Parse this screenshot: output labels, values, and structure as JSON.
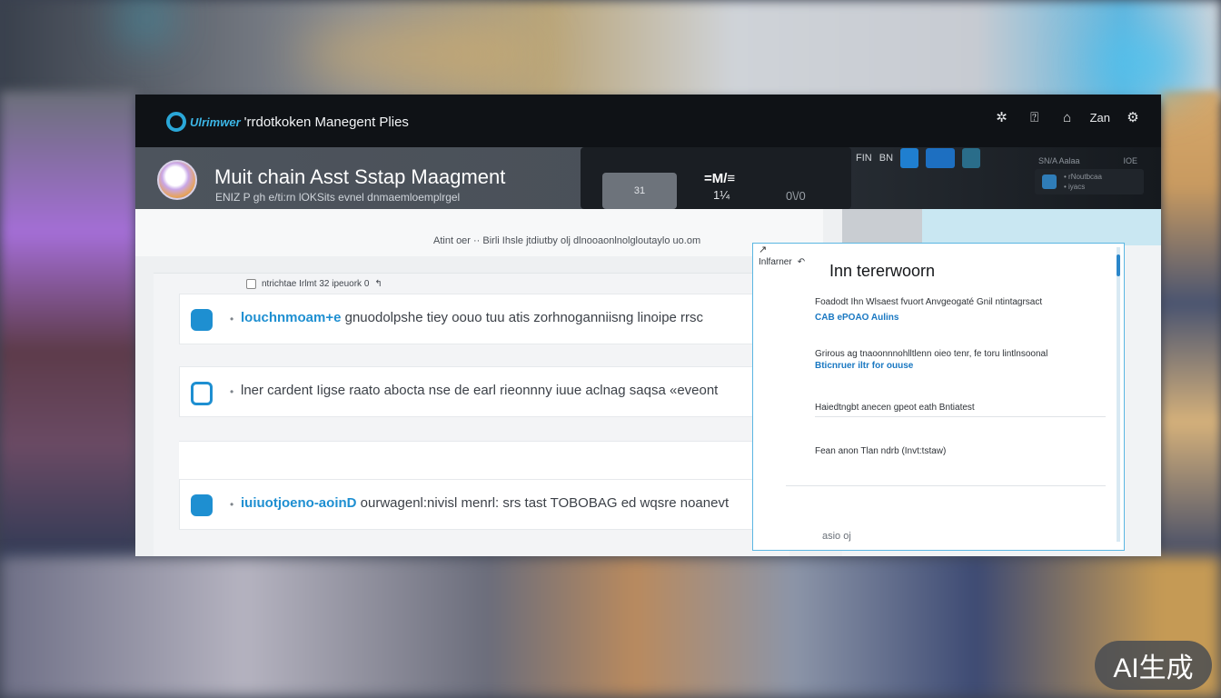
{
  "topbar": {
    "brand_mark": "Ulrimwer",
    "title": "'rrdotkoken Manegent Plies",
    "icons": [
      "settings-cluster-icon",
      "help-icon",
      "user-icon"
    ],
    "user_label": "Zan"
  },
  "header": {
    "title": "Muit chain Asst Sstap Maagment",
    "subtitle": "ENIZ P gh e/ti:rn lOKSits evnel dnmaemloemplrgel"
  },
  "mini_panel": {
    "button_label": "31",
    "stat1": "=M/≡",
    "stat2": "1¼",
    "stat3": "0\\/0"
  },
  "tabs": {
    "labels": [
      "FIN",
      "BN"
    ],
    "meta": [
      "SN/A Aalaa",
      "IOE"
    ],
    "right_card": "• rNoutbcaa\n• iyacs"
  },
  "notice": {
    "text": "Atint oer ·· Birli Ihsle jtdiutby olj dlnooaonlnolgloutaylo uo.om"
  },
  "list": {
    "header": "ntrichtae Irlmt 32 ipeuork 0",
    "rows": [
      {
        "accent": "louchnmoam+e",
        "text": " gnuodolpshe tiey oouo tuu atis zorhnoganniisng linoipe rrsc"
      },
      {
        "accent": "",
        "text": "lner cardent Iigse raato abocta nse de earl rieonnny iuue aclnag saqsa «eveont"
      },
      {
        "accent": "iuiuotjoeno-aoinD",
        "text": " ourwagenl:nivisl menrl: srs tast TOBOBAG ed wqsre noanevt"
      }
    ]
  },
  "drawer": {
    "crumb": "Inlfarner",
    "title": "Inn tererwoorn",
    "sections": [
      {
        "p": "Foadodt Ihn Wlsaest fvuort Anvgeogaté Gnil ntintagrsact",
        "link": "CAB ePOAO Aulins"
      },
      {
        "p": "Grirous ag tnaoonnnohlltlenn oieo tenr, fe toru lintlnsoonal",
        "link": "Bticnruer iltr for ouuse"
      },
      {
        "p": "Haiedtngbt anecen gpeot eath Bntiatest",
        "link": ""
      },
      {
        "p": "Fean anon Tlan ndrb (Invt:tstaw)",
        "link": ""
      }
    ],
    "footer": "asio oj"
  },
  "watermark": "AI生成"
}
